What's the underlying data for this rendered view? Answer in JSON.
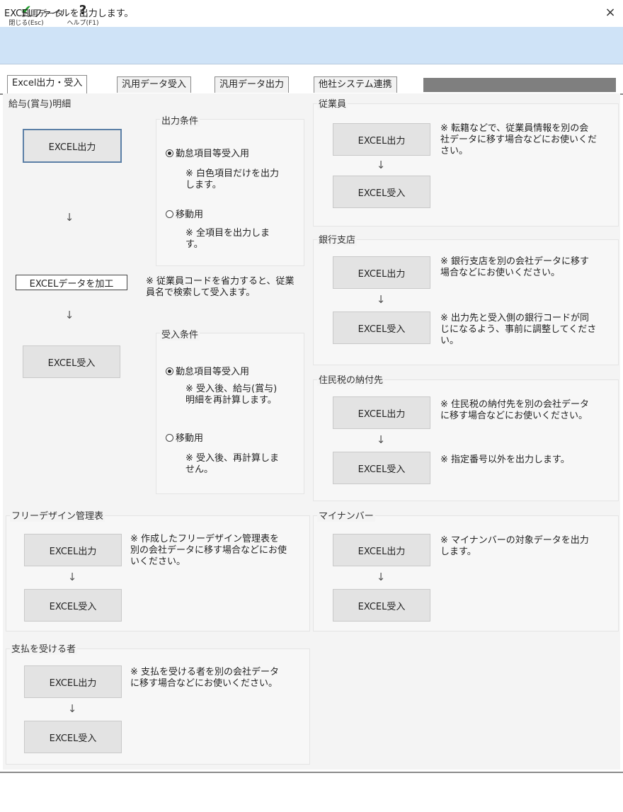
{
  "window": {
    "title": "汎用データ",
    "close_symbol": "×"
  },
  "toolbar": {
    "close": {
      "icon": "checkmark-icon",
      "glyph": "✔",
      "label": "閉じる(Esc)"
    },
    "help": {
      "icon": "help-icon",
      "glyph": "?",
      "label": "ヘルプ(F1)"
    }
  },
  "tabs": [
    {
      "label": "Excel出力・受入",
      "active": true
    },
    {
      "label": "汎用データ受入",
      "active": false
    },
    {
      "label": "汎用データ出力",
      "active": false
    },
    {
      "label": "他社システム連携",
      "active": false
    }
  ],
  "kyuyo": {
    "title": "給与(賞与)明細",
    "export_label": "EXCEL出力",
    "edit_label": "EXCELデータを加工",
    "import_label": "EXCEL受入",
    "arrow": "↓",
    "code_note": "※ 従業員コードを省力すると、従業員名で検索して受入ます。",
    "output_cond": {
      "title": "出力条件",
      "opt1": "勤怠項目等受入用",
      "opt1_note": "※ 白色項目だけを出力します。",
      "opt2": "移動用",
      "opt2_note": "※ 全項目を出力します。"
    },
    "input_cond": {
      "title": "受入条件",
      "opt1": "勤怠項目等受入用",
      "opt1_note": "※ 受入後、給与(賞与)明細を再計算します。",
      "opt2": "移動用",
      "opt2_note": "※ 受入後、再計算しません。"
    }
  },
  "employees": {
    "title": "従業員",
    "export_label": "EXCEL出力",
    "import_label": "EXCEL受入",
    "arrow": "↓",
    "note": "※ 転籍などで、従業員情報を別の会社データに移す場合などにお使いください。"
  },
  "bank": {
    "title": "銀行支店",
    "export_label": "EXCEL出力",
    "import_label": "EXCEL受入",
    "arrow": "↓",
    "note1": "※ 銀行支店を別の会社データに移す場合などにお使いください。",
    "note2": "※ 出力先と受入側の銀行コードが同じになるよう、事前に調整してください。"
  },
  "residence_tax": {
    "title": "住民税の納付先",
    "export_label": "EXCEL出力",
    "import_label": "EXCEL受入",
    "arrow": "↓",
    "note1": "※ 住民税の納付先を別の会社データに移す場合などにお使いください。",
    "note2": "※ 指定番号以外を出力します。"
  },
  "free_design": {
    "title": "フリーデザイン管理表",
    "export_label": "EXCEL出力",
    "import_label": "EXCEL受入",
    "arrow": "↓",
    "note": "※ 作成したフリーデザイン管理表を別の会社データに移す場合などにお使いください。"
  },
  "my_number": {
    "title": "マイナンバー",
    "export_label": "EXCEL出力",
    "import_label": "EXCEL受入",
    "arrow": "↓",
    "note": "※ マイナンバーの対象データを出力します。"
  },
  "payees": {
    "title": "支払を受ける者",
    "export_label": "EXCEL出力",
    "import_label": "EXCEL受入",
    "arrow": "↓",
    "note": "※ 支払を受ける者を別の会社データに移す場合などにお使いください。"
  },
  "status": {
    "text": "EXCELファイルを出力します。"
  }
}
